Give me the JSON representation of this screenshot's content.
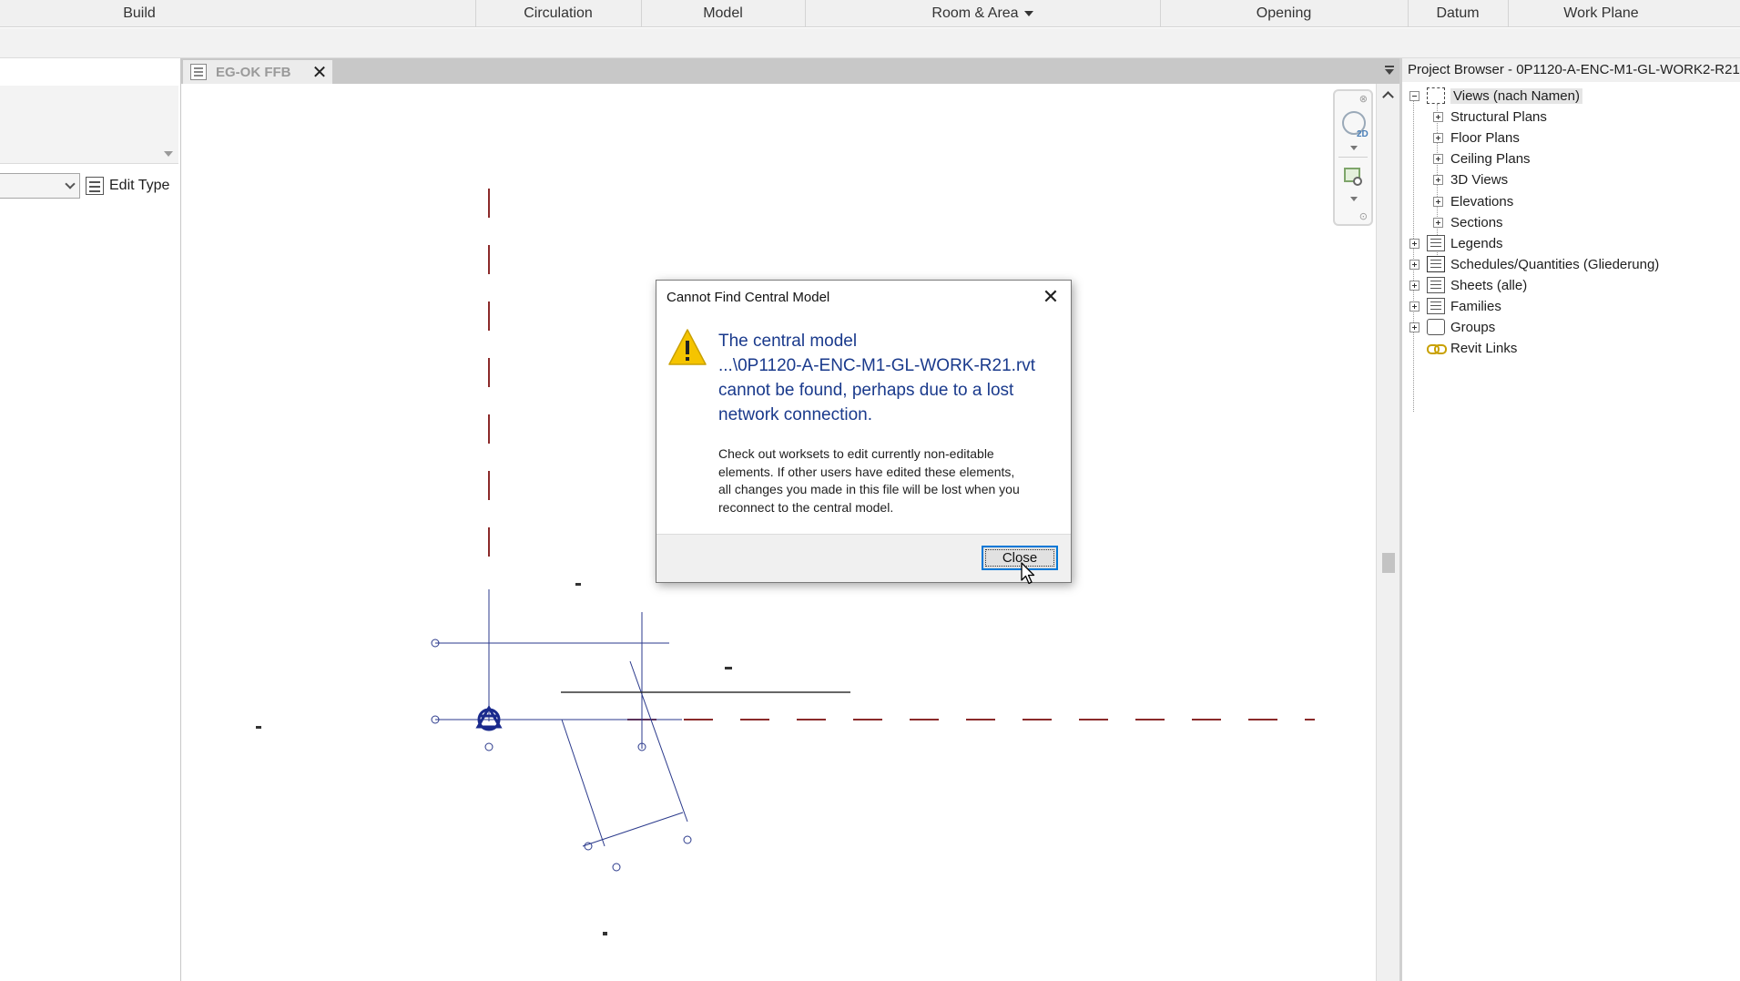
{
  "ribbon": {
    "panels": [
      {
        "label": "Build",
        "has_dropdown": false
      },
      {
        "label": "Circulation",
        "has_dropdown": false
      },
      {
        "label": "Model",
        "has_dropdown": false
      },
      {
        "label": "Room & Area",
        "has_dropdown": true
      },
      {
        "label": "Opening",
        "has_dropdown": false
      },
      {
        "label": "Datum",
        "has_dropdown": false
      },
      {
        "label": "Work Plane",
        "has_dropdown": false
      }
    ]
  },
  "properties": {
    "edit_type_label": "Edit Type"
  },
  "view_tab": {
    "label": "EG-OK FFB",
    "close_glyph": "✕"
  },
  "project_browser": {
    "title": "Project Browser - 0P1120-A-ENC-M1-GL-WORK2-R21",
    "root": {
      "label": "Views (nach Namen)",
      "expanded": true,
      "selected": true,
      "icon": "views-icon"
    },
    "view_children": [
      {
        "label": "Structural Plans"
      },
      {
        "label": "Floor Plans"
      },
      {
        "label": "Ceiling Plans"
      },
      {
        "label": "3D Views"
      },
      {
        "label": "Elevations"
      },
      {
        "label": "Sections"
      }
    ],
    "top_items": [
      {
        "label": "Legends",
        "icon": "legend-icon"
      },
      {
        "label": "Schedules/Quantities (Gliederung)",
        "icon": "schedule-icon"
      },
      {
        "label": "Sheets (alle)",
        "icon": "sheet-icon"
      },
      {
        "label": "Families",
        "icon": "family-icon"
      },
      {
        "label": "Groups",
        "icon": "group-icon"
      },
      {
        "label": "Revit Links",
        "icon": "revit-links-icon"
      }
    ]
  },
  "navigation_bar": {
    "wheel_tag": "2D"
  },
  "dialog": {
    "title": "Cannot Find Central Model",
    "close_glyph": "✕",
    "icon": "warning-icon",
    "main_lines": [
      "The central model",
      "...\\0P1120-A-ENC-M1-GL-WORK-R21.rvt",
      "cannot be found, perhaps due to a lost",
      "network connection."
    ],
    "body_lines": [
      "Check out worksets to edit currently non-editable",
      "elements.  If other users have edited these elements,",
      "all changes you made in this file will be lost when you",
      "reconnect to the central model."
    ],
    "close_button_label": "Close"
  },
  "colors": {
    "dialog_main_text": "#1a3a8c",
    "button_focus": "#0078d7",
    "grid_line": "#8b2a2a",
    "model_line": "#2b3a8c",
    "warning_yellow": "#f5c400"
  }
}
